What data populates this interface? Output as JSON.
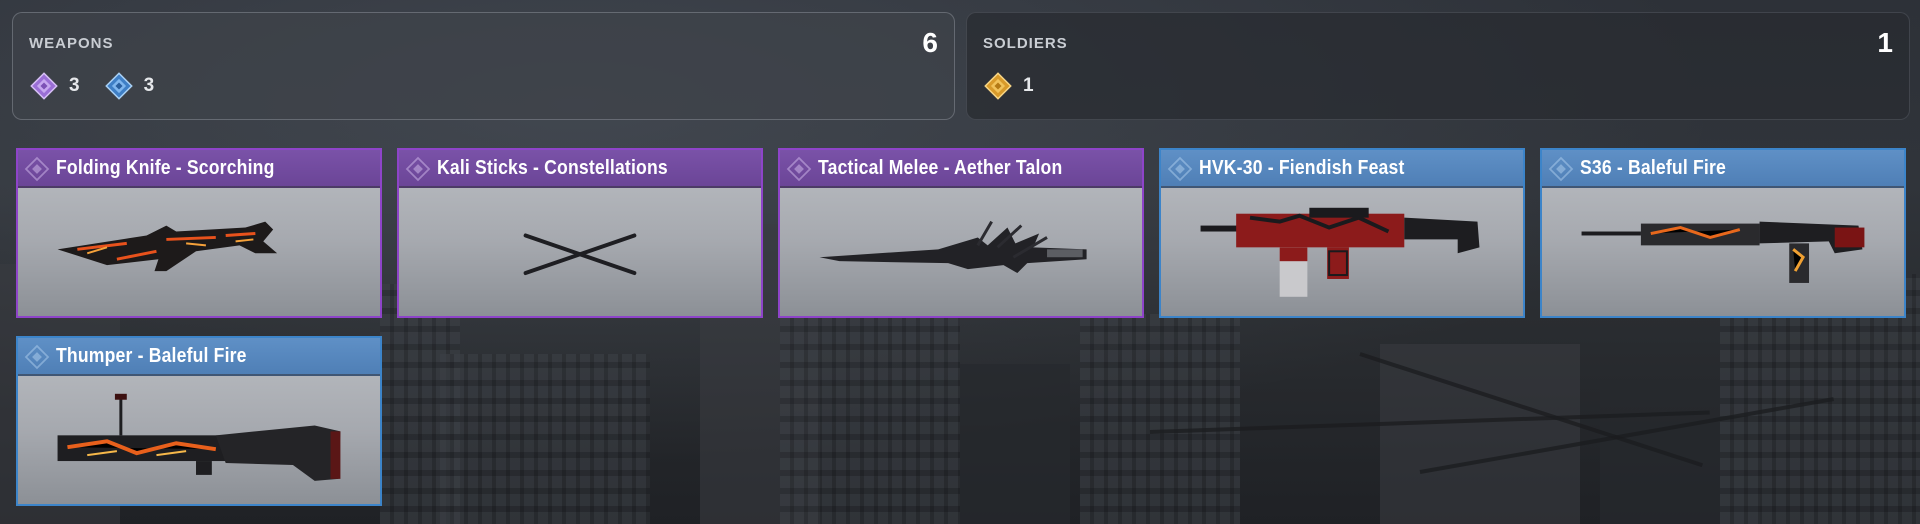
{
  "summary": {
    "weapons": {
      "title": "WEAPONS",
      "total": "6",
      "rarity_counts": [
        {
          "icon": "epic-gem-icon",
          "color": "#b07ee6",
          "count": "3"
        },
        {
          "icon": "rare-gem-icon",
          "color": "#5aa0e6",
          "count": "3"
        }
      ]
    },
    "soldiers": {
      "title": "SOLDIERS",
      "total": "1",
      "rarity_counts": [
        {
          "icon": "legendary-gem-icon",
          "color": "#e6b040",
          "count": "1"
        }
      ]
    }
  },
  "colors": {
    "epic": "#8e44c9",
    "rare": "#3c84c9",
    "legendary": "#e6b040"
  },
  "items": [
    {
      "name": "Folding Knife - Scorching",
      "rarity": "epic"
    },
    {
      "name": "Kali Sticks - Constellations",
      "rarity": "epic"
    },
    {
      "name": "Tactical Melee - Aether Talon",
      "rarity": "epic"
    },
    {
      "name": "HVK-30 - Fiendish Feast",
      "rarity": "rare"
    },
    {
      "name": "S36 - Baleful Fire",
      "rarity": "rare"
    },
    {
      "name": "Thumper - Baleful Fire",
      "rarity": "rare"
    }
  ]
}
